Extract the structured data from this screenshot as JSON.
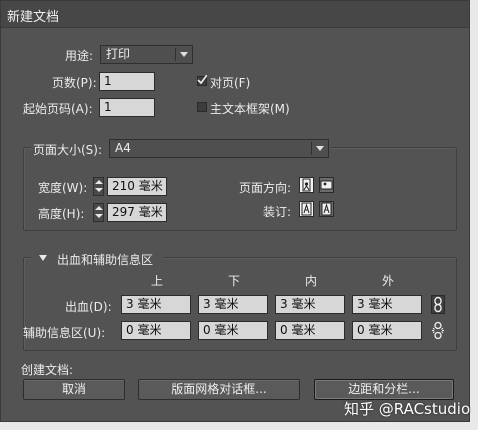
{
  "window": {
    "title": "新建文档"
  },
  "top": {
    "purpose_label": "用途:",
    "purpose_value": "打印",
    "pages_label": "页数(P):",
    "pages_value": "1",
    "start_page_label": "起始页码(A):",
    "start_page_value": "1",
    "facing_pages_label": "对页(F)",
    "facing_pages_checked": true,
    "master_text_frame_label": "主文本框架(M)",
    "master_text_frame_checked": false
  },
  "page_size": {
    "label": "页面大小(S):",
    "value": "A4",
    "width_label": "宽度(W):",
    "width_value": "210 毫米",
    "height_label": "高度(H):",
    "height_value": "297 毫米",
    "orientation_label": "页面方向:",
    "orientation_icons": [
      "portrait-icon",
      "landscape-icon"
    ],
    "binding_label": "装订:",
    "binding_icons": [
      "left-to-right-binding-icon",
      "right-to-left-binding-icon"
    ]
  },
  "bleed_slug": {
    "section_label": "出血和辅助信息区",
    "columns": [
      "上",
      "下",
      "内",
      "外"
    ],
    "bleed_label": "出血(D):",
    "bleed_values": [
      "3 毫米",
      "3 毫米",
      "3 毫米",
      "3 毫米"
    ],
    "slug_label": "辅助信息区(U):",
    "slug_values": [
      "0 毫米",
      "0 毫米",
      "0 毫米",
      "0 毫米"
    ],
    "link_icons": [
      "chain-linked-icon",
      "chain-unlinked-icon"
    ]
  },
  "create": {
    "label": "创建文档:",
    "cancel_label": "取消",
    "layout_grid_label": "版面网格对话框...",
    "margins_columns_label": "边距和分栏..."
  },
  "watermark": "知乎 @RACstudio",
  "colors": {
    "dialog_bg": "#535353",
    "field_bg": "#d7d7d7",
    "text": "#ececec"
  }
}
